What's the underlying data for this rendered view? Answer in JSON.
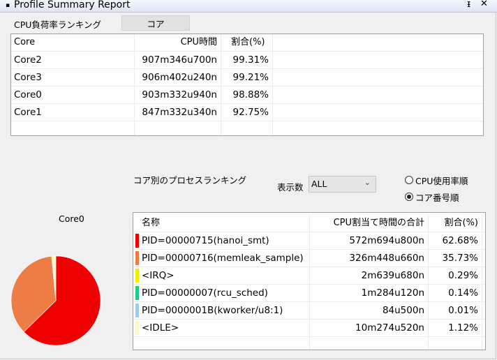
{
  "window": {
    "title": "Profile Summary Report"
  },
  "cpu_ranking": {
    "label": "CPU負荷率ランキング",
    "button_label": "コア",
    "columns": [
      "Core",
      "CPU時間",
      "割合(%)"
    ],
    "rows": [
      {
        "core": "Core2",
        "time": "907m346u700n",
        "percent": "99.31%"
      },
      {
        "core": "Core3",
        "time": "906m402u240n",
        "percent": "99.21%"
      },
      {
        "core": "Core0",
        "time": "903m332u940n",
        "percent": "98.88%"
      },
      {
        "core": "Core1",
        "time": "847m332u340n",
        "percent": "92.75%"
      }
    ]
  },
  "process_ranking": {
    "label": "コア別のプロセスランキング",
    "display_count_label": "表示数",
    "display_count_value": "ALL",
    "sort_options": [
      {
        "label": "CPU使用率順",
        "selected": false
      },
      {
        "label": "コア番号順",
        "selected": true
      }
    ],
    "pie_title": "Core0",
    "columns": [
      "名称",
      "CPU割当て時間の合計",
      "割合(%)"
    ],
    "rows": [
      {
        "name": "PID=00000715(hanoi_smt)",
        "time": "572m694u800n",
        "percent": "62.68%",
        "value": 62.68,
        "color": "#ee0000"
      },
      {
        "name": "PID=00000716(memleak_sample)",
        "time": "326m448u660n",
        "percent": "35.73%",
        "value": 35.73,
        "color": "#ee7d45"
      },
      {
        "name": "<IRQ>",
        "time": "2m639u680n",
        "percent": "0.29%",
        "value": 0.29,
        "color": "#f2ee00"
      },
      {
        "name": "PID=00000007(rcu_sched)",
        "time": "1m284u120n",
        "percent": "0.14%",
        "value": 0.14,
        "color": "#22cc88"
      },
      {
        "name": "PID=0000001B(kworker/u8:1)",
        "time": "84u500n",
        "percent": "0.01%",
        "value": 0.01,
        "color": "#9ecbe8"
      },
      {
        "name": "<IDLE>",
        "time": "10m274u520n",
        "percent": "1.12%",
        "value": 1.12,
        "color": "#fbf6d0"
      }
    ]
  }
}
